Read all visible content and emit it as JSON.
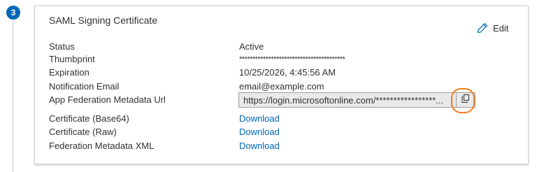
{
  "step": {
    "number": "3"
  },
  "card": {
    "title": "SAML Signing Certificate",
    "edit_label": "Edit",
    "edit_icon": "pencil-icon"
  },
  "fields": {
    "status": {
      "label": "Status",
      "value": "Active"
    },
    "thumbprint": {
      "label": "Thumbprint",
      "value": "****************************************"
    },
    "expiration": {
      "label": "Expiration",
      "value": "10/25/2026, 4:45:56 AM"
    },
    "notification_email": {
      "label": "Notification Email",
      "value": "email@example.com"
    },
    "metadata_url": {
      "label": "App Federation Metadata Url",
      "value": "https://login.microsoftonline.com/*****************...",
      "copy_icon": "copy-icon"
    },
    "cert_base64": {
      "label": "Certificate (Base64)",
      "link": "Download"
    },
    "cert_raw": {
      "label": "Certificate (Raw)",
      "link": "Download"
    },
    "federation_xml": {
      "label": "Federation Metadata XML",
      "link": "Download"
    }
  },
  "colors": {
    "accent": "#0067b8",
    "highlight": "#f07d1e",
    "text": "#323130"
  }
}
